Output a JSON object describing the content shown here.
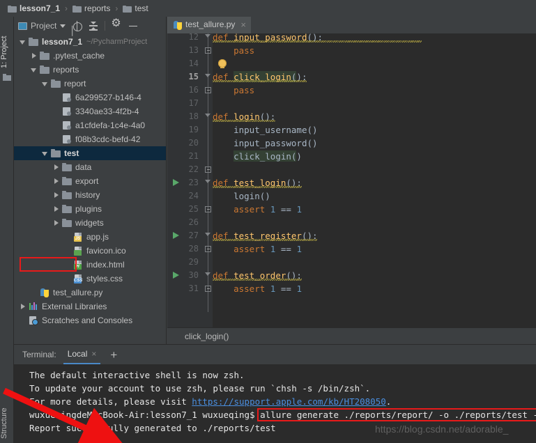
{
  "breadcrumb": {
    "items": [
      {
        "label": "lesson7_1",
        "icon": "folder-icon",
        "bold": true
      },
      {
        "label": "reports",
        "icon": "folder-icon",
        "bold": false
      },
      {
        "label": "test",
        "icon": "folder-icon",
        "bold": false
      }
    ],
    "separator": "›"
  },
  "left_strip": {
    "project_tab": "1: Project",
    "structure_tab": "Structure"
  },
  "project_panel": {
    "toolbar": {
      "title": "Project",
      "caret": "chevron-down-icon",
      "locate_icon": "target-icon",
      "collapse_icon": "collapse-all-icon",
      "settings_icon": "gear-icon",
      "hide_icon": "minimize-icon"
    },
    "tree": [
      {
        "label": "lesson7_1",
        "sub": "~/PycharmProject",
        "indent": 0,
        "arrow": "down",
        "icon": "folder-icon",
        "bold": true,
        "selected": false
      },
      {
        "label": ".pytest_cache",
        "sub": "",
        "indent": 1,
        "arrow": "right",
        "icon": "folder-icon",
        "bold": false,
        "selected": false
      },
      {
        "label": "reports",
        "sub": "",
        "indent": 1,
        "arrow": "down",
        "icon": "folder-icon",
        "bold": false,
        "selected": false
      },
      {
        "label": "report",
        "sub": "",
        "indent": 2,
        "arrow": "down",
        "icon": "folder-icon",
        "bold": false,
        "selected": false
      },
      {
        "label": "6a299527-b146-4",
        "sub": "",
        "indent": 3,
        "arrow": "none",
        "icon": "generic-file-icon",
        "bold": false,
        "selected": false
      },
      {
        "label": "3340ae33-4f2b-4",
        "sub": "",
        "indent": 3,
        "arrow": "none",
        "icon": "generic-file-icon",
        "bold": false,
        "selected": false
      },
      {
        "label": "a1cfdefa-1c4e-4a0",
        "sub": "",
        "indent": 3,
        "arrow": "none",
        "icon": "generic-file-icon",
        "bold": false,
        "selected": false
      },
      {
        "label": "f08b3cdc-befd-42",
        "sub": "",
        "indent": 3,
        "arrow": "none",
        "icon": "generic-file-icon",
        "bold": false,
        "selected": false
      },
      {
        "label": "test",
        "sub": "",
        "indent": 2,
        "arrow": "down",
        "icon": "folder-icon",
        "bold": true,
        "selected": true
      },
      {
        "label": "data",
        "sub": "",
        "indent": 3,
        "arrow": "right",
        "icon": "folder-icon",
        "bold": false,
        "selected": false
      },
      {
        "label": "export",
        "sub": "",
        "indent": 3,
        "arrow": "right",
        "icon": "folder-icon",
        "bold": false,
        "selected": false
      },
      {
        "label": "history",
        "sub": "",
        "indent": 3,
        "arrow": "right",
        "icon": "folder-icon",
        "bold": false,
        "selected": false
      },
      {
        "label": "plugins",
        "sub": "",
        "indent": 3,
        "arrow": "right",
        "icon": "folder-icon",
        "bold": false,
        "selected": false
      },
      {
        "label": "widgets",
        "sub": "",
        "indent": 3,
        "arrow": "right",
        "icon": "folder-icon",
        "bold": false,
        "selected": false
      },
      {
        "label": "app.js",
        "sub": "",
        "indent": 4,
        "arrow": "none",
        "icon": "js-file-icon",
        "bold": false,
        "selected": false
      },
      {
        "label": "favicon.ico",
        "sub": "",
        "indent": 4,
        "arrow": "none",
        "icon": "image-file-icon",
        "bold": false,
        "selected": false
      },
      {
        "label": "index.html",
        "sub": "",
        "indent": 4,
        "arrow": "none",
        "icon": "html-file-icon",
        "bold": false,
        "selected": false
      },
      {
        "label": "styles.css",
        "sub": "",
        "indent": 4,
        "arrow": "none",
        "icon": "css-file-icon",
        "bold": false,
        "selected": false
      },
      {
        "label": "test_allure.py",
        "sub": "",
        "indent": 1,
        "arrow": "none",
        "icon": "python-file-icon",
        "bold": false,
        "selected": false
      },
      {
        "label": "External Libraries",
        "sub": "",
        "indent": 0,
        "arrow": "right",
        "icon": "libraries-icon",
        "bold": false,
        "selected": false
      },
      {
        "label": "Scratches and Consoles",
        "sub": "",
        "indent": 0,
        "arrow": "none",
        "icon": "scratches-icon",
        "bold": false,
        "selected": false
      }
    ],
    "highlight_index": 16
  },
  "editor": {
    "tab": {
      "label": "test_allure.py",
      "icon": "python-file-icon",
      "close": "×"
    },
    "first_line_number": 12,
    "lines": [
      {
        "num": 12,
        "text": "def input_password():",
        "partial": true
      },
      {
        "num": 13,
        "text": "    pass"
      },
      {
        "num": 14,
        "text": ""
      },
      {
        "num": 15,
        "text": "def click_login():",
        "current": true
      },
      {
        "num": 16,
        "text": "    pass"
      },
      {
        "num": 17,
        "text": ""
      },
      {
        "num": 18,
        "text": "def login():"
      },
      {
        "num": 19,
        "text": "    input_username()"
      },
      {
        "num": 20,
        "text": "    input_password()"
      },
      {
        "num": 21,
        "text": "    click_login()"
      },
      {
        "num": 22,
        "text": ""
      },
      {
        "num": 23,
        "text": "def test_login():",
        "runnable": true
      },
      {
        "num": 24,
        "text": "    login()"
      },
      {
        "num": 25,
        "text": "    assert 1 == 1"
      },
      {
        "num": 26,
        "text": ""
      },
      {
        "num": 27,
        "text": "def test_register():",
        "runnable": true
      },
      {
        "num": 28,
        "text": "    assert 1 == 1"
      },
      {
        "num": 29,
        "text": ""
      },
      {
        "num": 30,
        "text": "def test_order():",
        "runnable": true
      },
      {
        "num": 31,
        "text": "    assert 1 == 1"
      }
    ],
    "status_breadcrumb": "click_login()"
  },
  "terminal": {
    "title": "Terminal:",
    "tab_label": "Local",
    "tab_close": "×",
    "add_label": "+",
    "lines": [
      {
        "kind": "text",
        "text": "The default interactive shell is now zsh."
      },
      {
        "kind": "text",
        "text": "To update your account to use zsh, please run `chsh -s /bin/zsh`."
      },
      {
        "kind": "link",
        "prefix": "For more details, please visit ",
        "link": "https://support.apple.com/kb/HT208050",
        "suffix": "."
      },
      {
        "kind": "prompt",
        "prompt": "wuxueqingdeMacBook-Air:lesson7_1 wuxueqing$ ",
        "command": "allure generate ./reports/report/ -o ./reports/test --clean"
      },
      {
        "kind": "text",
        "text": "Report successfully generated to ./reports/test"
      }
    ]
  },
  "watermark": {
    "text": "https://blog.csdn.net/adorable_"
  },
  "colors": {
    "accent": "#4a88c7",
    "highlight_box": "#e81a1a",
    "selection": "#0d293e",
    "keyword": "#cc7832",
    "function": "#ffc66d",
    "number": "#6897bb",
    "identifier": "#a9b7c6",
    "run_marker": "#59a869",
    "link": "#4a8fe0",
    "editor_bg": "#2b2b2b",
    "panel_bg": "#3c3f41"
  }
}
